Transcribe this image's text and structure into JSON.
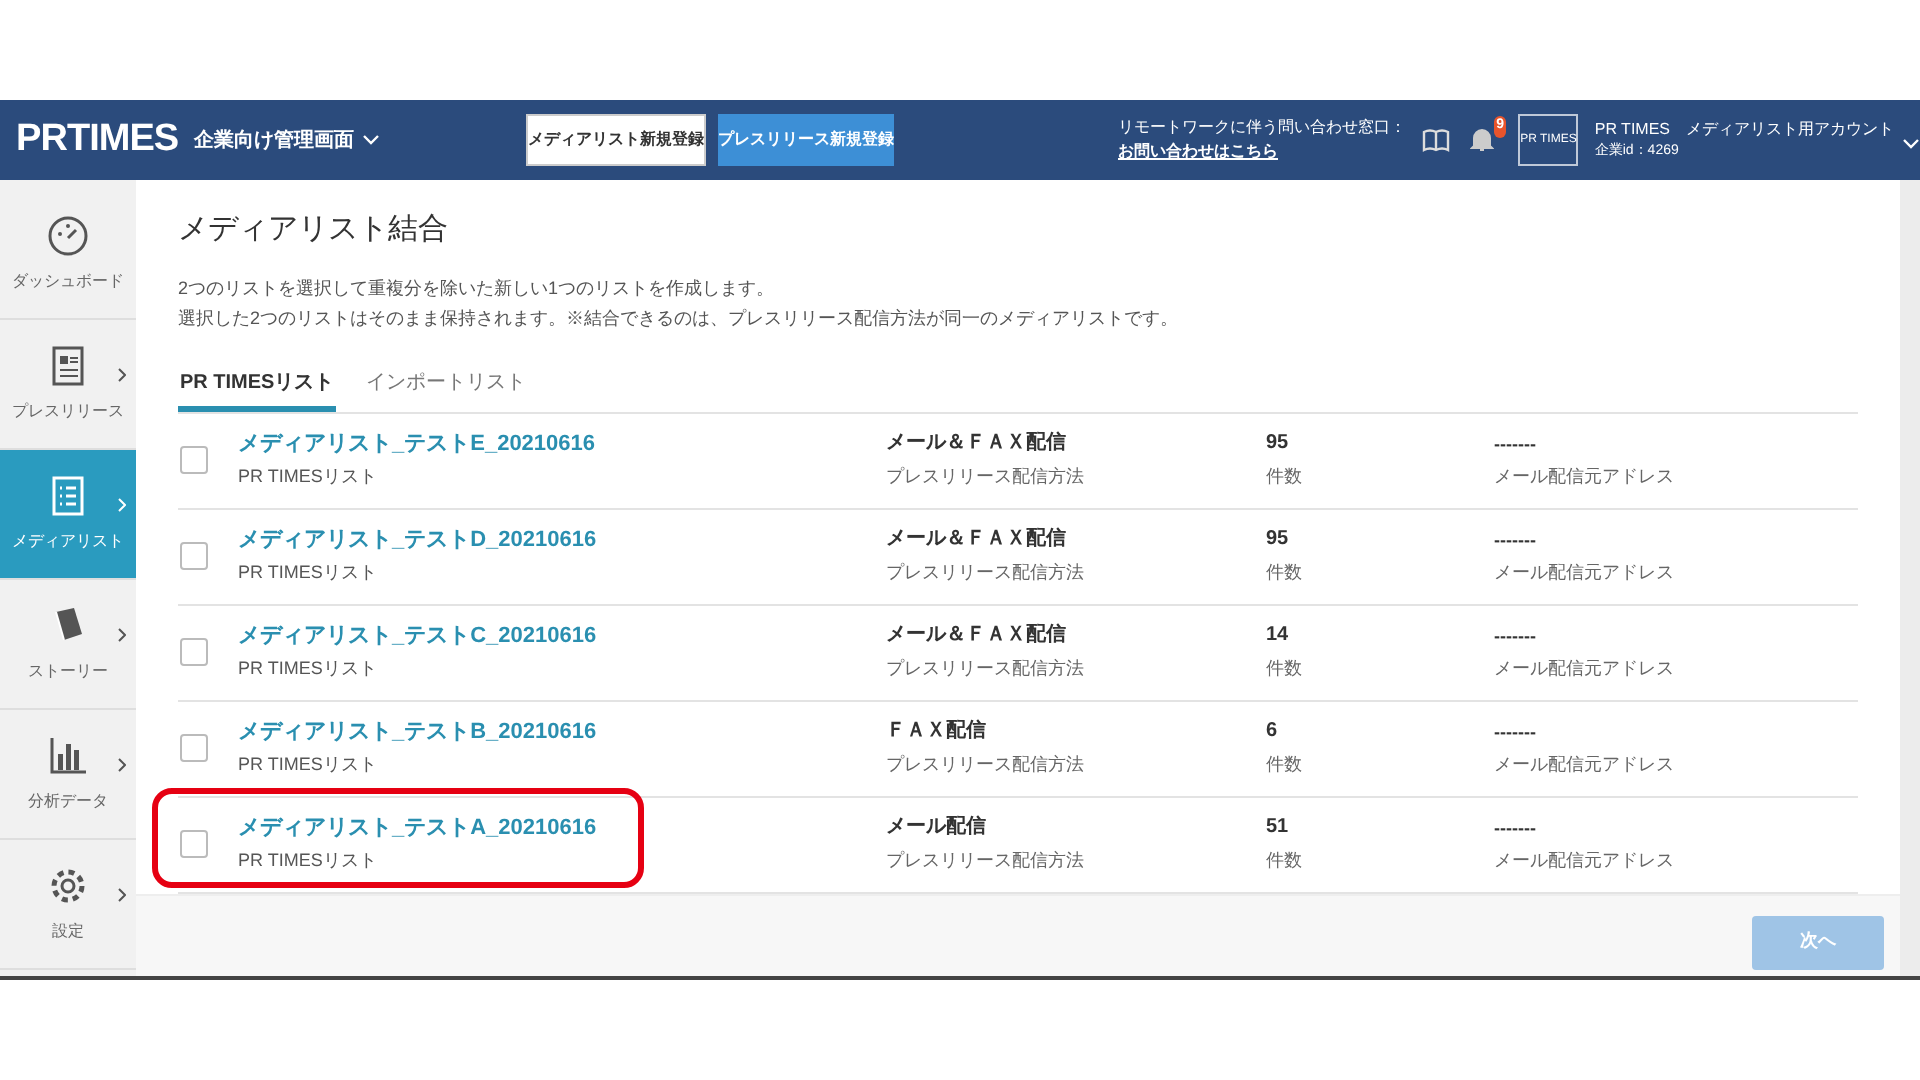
{
  "header": {
    "logo": "PRTIMES",
    "console": "企業向け管理画面",
    "buttons": [
      {
        "label": "メディアリスト新規登録",
        "kind": "secondary"
      },
      {
        "label": "プレスリリース新規登録",
        "kind": "primary"
      }
    ],
    "contact_label": "リモートワークに伴う問い合わせ窓口：",
    "contact_link": "お問い合わせはこちら",
    "notification_count": "9",
    "account_thumb": "PR TIMES",
    "account_name": "PR TIMES　メディアリスト用アカウント",
    "company_id": "企業id：4269"
  },
  "sidebar": {
    "items": [
      {
        "label": "ダッシュボード",
        "selected": false,
        "arrow": false
      },
      {
        "label": "プレスリリース",
        "selected": false,
        "arrow": true
      },
      {
        "label": "メディアリスト",
        "selected": true,
        "arrow": true
      },
      {
        "label": "ストーリー",
        "selected": false,
        "arrow": true
      },
      {
        "label": "分析データ",
        "selected": false,
        "arrow": true
      },
      {
        "label": "設定",
        "selected": false,
        "arrow": true
      }
    ]
  },
  "page": {
    "title": "メディアリスト結合",
    "description": [
      "2つのリストを選択して重複分を除いた新しい1つのリストを作成します。",
      "選択した2つのリストはそのまま保持されます。※結合できるのは、プレスリリース配信方法が同一のメディアリストです。"
    ]
  },
  "tabs": [
    {
      "label": "PR TIMESリスト",
      "selected": true
    },
    {
      "label": "インポートリスト",
      "selected": false
    }
  ],
  "rows": [
    {
      "name": "メディアリスト_テストE_20210616",
      "source": "PR TIMESリスト",
      "method": "メール＆ＦＡＸ配信",
      "method_label": "プレスリリース配信方法",
      "count": "95",
      "count_label": "件数",
      "address": "-------",
      "address_label": "メール配信元アドレス",
      "checked": false,
      "highlighted": false
    },
    {
      "name": "メディアリスト_テストD_20210616",
      "source": "PR TIMESリスト",
      "method": "メール＆ＦＡＸ配信",
      "method_label": "プレスリリース配信方法",
      "count": "95",
      "count_label": "件数",
      "address": "-------",
      "address_label": "メール配信元アドレス",
      "checked": false,
      "highlighted": false
    },
    {
      "name": "メディアリスト_テストC_20210616",
      "source": "PR TIMESリスト",
      "method": "メール＆ＦＡＸ配信",
      "method_label": "プレスリリース配信方法",
      "count": "14",
      "count_label": "件数",
      "address": "-------",
      "address_label": "メール配信元アドレス",
      "checked": false,
      "highlighted": false
    },
    {
      "name": "メディアリスト_テストB_20210616",
      "source": "PR TIMESリスト",
      "method": "ＦＡＸ配信",
      "method_label": "プレスリリース配信方法",
      "count": "6",
      "count_label": "件数",
      "address": "-------",
      "address_label": "メール配信元アドレス",
      "checked": false,
      "highlighted": false
    },
    {
      "name": "メディアリスト_テストA_20210616",
      "source": "PR TIMESリスト",
      "method": "メール配信",
      "method_label": "プレスリリース配信方法",
      "count": "51",
      "count_label": "件数",
      "address": "-------",
      "address_label": "メール配信元アドレス",
      "checked": false,
      "highlighted": true
    }
  ],
  "next_button": {
    "label": "次へ",
    "disabled": true
  }
}
